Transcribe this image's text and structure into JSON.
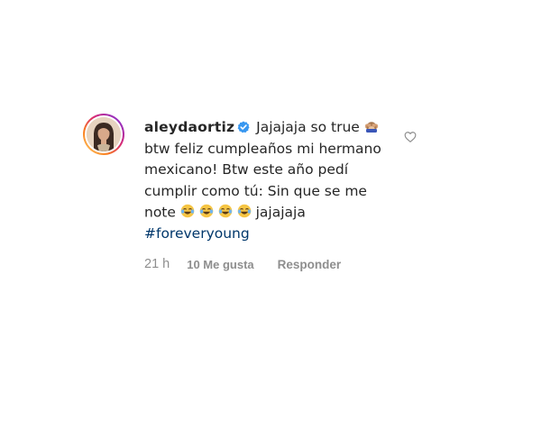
{
  "comment": {
    "username": "aleydaortiz",
    "verified": true,
    "text_part1": "Jajajaja so true",
    "text_part2": "btw feliz cumpleaños mi hermano mexicano! Btw este año pedí cumplir como tú: Sin que se me note",
    "text_part3": "jajajaja",
    "hashtag": "#foreveryoung",
    "emojis": [
      "see-no-evil-monkey-emoji",
      "joy-emoji",
      "joy-emoji",
      "joy-emoji",
      "joy-emoji"
    ],
    "time": "21 h",
    "likes": "10 Me gusta",
    "reply_label": "Responder"
  },
  "colors": {
    "text": "#262626",
    "muted": "#8e8e8e",
    "link": "#00376b",
    "verified": "#3897f0"
  }
}
